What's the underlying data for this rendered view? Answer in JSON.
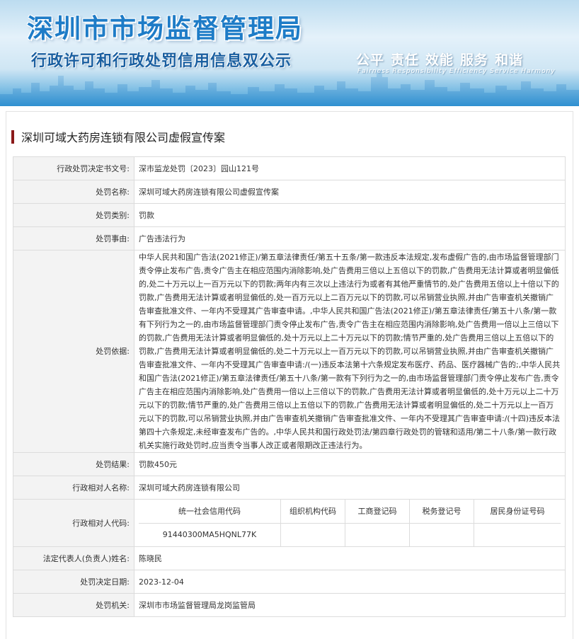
{
  "banner": {
    "title": "深圳市市场监督管理局",
    "subtitle": "行政许可和行政处罚信用信息双公示",
    "slogan": [
      "公平",
      "责任",
      "效能",
      "服务",
      "和谐"
    ],
    "slogan_en": "Fairness Responsibility Efficiency Service Harmony"
  },
  "page_title": "深圳可域大药房连锁有限公司虚假宣传案",
  "rows": {
    "decision_no": {
      "label": "行政处罚决定书文号:",
      "value": "深市监龙处罚〔2023〕园山121号"
    },
    "case_name": {
      "label": "处罚名称:",
      "value": "深圳可域大药房连锁有限公司虚假宣传案"
    },
    "category": {
      "label": "处罚类别:",
      "value": "罚款"
    },
    "reason": {
      "label": "处罚事由:",
      "value": "广告违法行为"
    },
    "basis": {
      "label": "处罚依据:",
      "value": "中华人民共和国广告法(2021修正)/第五章法律责任/第五十五条/第一款违反本法规定,发布虚假广告的,由市场监督管理部门责令停止发布广告,责令广告主在相应范围内消除影响,处广告费用三倍以上五倍以下的罚款,广告费用无法计算或者明显偏低的,处二十万元以上一百万元以下的罚款;两年内有三次以上违法行为或者有其他严重情节的,处广告费用五倍以上十倍以下的罚款,广告费用无法计算或者明显偏低的,处一百万元以上二百万元以下的罚款,可以吊销营业执照,并由广告审查机关撤销广告审查批准文件、一年内不受理其广告审查申请。,中华人民共和国广告法(2021修正)/第五章法律责任/第五十八条/第一款有下列行为之一的,由市场监督管理部门责令停止发布广告,责令广告主在相应范围内消除影响,处广告费用一倍以上三倍以下的罚款,广告费用无法计算或者明显偏低的,处十万元以上二十万元以下的罚款;情节严重的,处广告费用三倍以上五倍以下的罚款,广告费用无法计算或者明显偏低的,处二十万元以上一百万元以下的罚款,可以吊销营业执照,并由广告审查机关撤销广告审查批准文件、一年内不受理其广告审查申请:/(一)违反本法第十六条规定发布医疗、药品、医疗器械广告的;,中华人民共和国广告法(2021修正)/第五章法律责任/第五十八条/第一款有下列行为之一的,由市场监督管理部门责令停止发布广告,责令广告主在相应范围内消除影响,处广告费用一倍以上三倍以下的罚款,广告费用无法计算或者明显偏低的,处十万元以上二十万元以下的罚款;情节严重的,处广告费用三倍以上五倍以下的罚款,广告费用无法计算或者明显偏低的,处二十万元以上一百万元以下的罚款,可以吊销营业执照,并由广告审查机关撤销广告审查批准文件、一年内不受理其广告审查申请:/(十四)违反本法第四十六条规定,未经审查发布广告的。,中华人民共和国行政处罚法/第四章行政处罚的管辖和适用/第二十八条/第一款行政机关实施行政处罚时,应当责令当事人改正或者限期改正违法行为。"
    },
    "result": {
      "label": "处罚结果:",
      "value": "罚款450元"
    },
    "party_name": {
      "label": "行政相对人名称:",
      "value": "深圳可域大药房连锁有限公司"
    },
    "party_code": {
      "label": "行政相对人代码:",
      "headers": [
        "统一社会信用代码",
        "组织机构代码",
        "工商登记码",
        "税务登记号",
        "居民身份证号码"
      ],
      "values": [
        "91440300MA5HQNL77K",
        "",
        "",
        "",
        ""
      ]
    },
    "legal_rep": {
      "label": "法定代表人(负责人)姓名:",
      "value": "陈晓民"
    },
    "decision_date": {
      "label": "处罚决定日期:",
      "value": "2023-12-04"
    },
    "authority": {
      "label": "处罚机关:",
      "value": "深圳市市场监督管理局龙岗监管局"
    }
  },
  "colors": {
    "title_bar": "#8b1a1a",
    "label_bg": "#f3f3f3",
    "border": "#dcdcdc",
    "banner_blue": "#1e7cc7"
  }
}
